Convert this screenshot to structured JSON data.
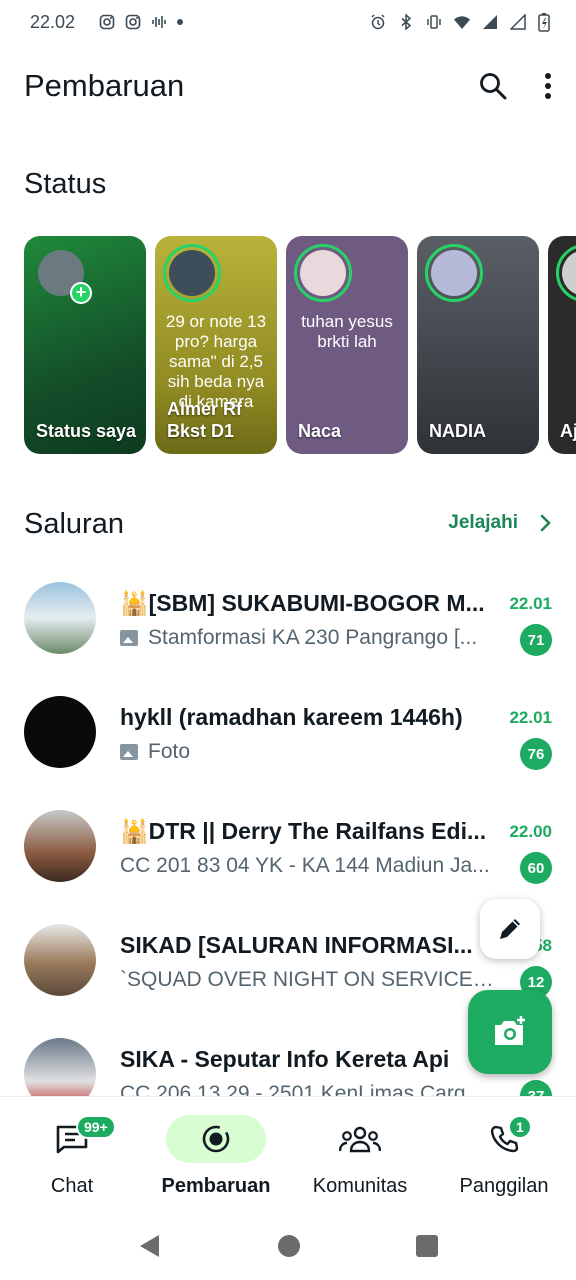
{
  "status_bar": {
    "time": "22.02",
    "left_icons": [
      "instagram-icon",
      "instagram-icon",
      "voice-icon",
      "dot-icon"
    ],
    "right_icons": [
      "alarm-icon",
      "bluetooth-icon",
      "vibrate-icon",
      "wifi-icon",
      "signal-icon",
      "signal-icon",
      "battery-charging-icon"
    ]
  },
  "appbar": {
    "title": "Pembaruan",
    "search_icon": "search-icon",
    "menu_icon": "more-vert-icon"
  },
  "status": {
    "section_title": "Status",
    "cards": [
      {
        "name": "Status saya",
        "text": "",
        "has_add": true,
        "bg": "#1f6b2a"
      },
      {
        "name": "Almer Rf Bkst D1",
        "text": "29 or note 13 pro? harga sama\" di 2,5 sih beda nya di kamera",
        "has_add": false,
        "bg": "#a9a32e"
      },
      {
        "name": "Naca",
        "text": "tuhan yesus brkti lah",
        "has_add": false,
        "bg": "#6f5a82"
      },
      {
        "name": "NADIA",
        "text": "",
        "has_add": false,
        "bg": "#3c3f44"
      },
      {
        "name": "Aj",
        "text": "",
        "has_add": false,
        "bg": "#2b2b2b"
      }
    ]
  },
  "channels": {
    "section_title": "Saluran",
    "explore_label": "Jelajahi",
    "items": [
      {
        "name": "🕌[SBM] SUKABUMI-BOGOR M...",
        "time": "22.01",
        "preview": "Stamformasi KA 230 Pangrango [...",
        "has_image": true,
        "unread": "71",
        "avatar_color": "#5f8aa8"
      },
      {
        "name": "hykll (ramadhan kareem 1446h)",
        "time": "22.01",
        "preview": "Foto",
        "has_image": true,
        "unread": "76",
        "avatar_color": "#0a0a0a"
      },
      {
        "name": "🕌DTR || Derry The Railfans Edi...",
        "time": "22.00",
        "preview": "CC 201 83 04 YK - KA 144 Madiun Ja...",
        "has_image": false,
        "unread": "60",
        "avatar_color": "#7a4b3a"
      },
      {
        "name": "SIKAD [SALURAN INFORMASI...",
        "time": "58",
        "preview": "`SQUAD OVER NIGHT ON SERVICES`...",
        "has_image": false,
        "unread": "12",
        "avatar_color": "#8a6a4a"
      },
      {
        "name": "SIKA - Seputar Info Kereta Api",
        "time": "",
        "preview": "CC 206 13 29 - 2501 KenLimas Carg...",
        "has_image": false,
        "unread": "37",
        "avatar_color": "#4a6a8a"
      }
    ]
  },
  "fab": {
    "edit_icon": "pencil-icon",
    "camera_icon": "camera-add-icon"
  },
  "bottom_nav": {
    "items": [
      {
        "label": "Chat",
        "icon": "chat-icon",
        "badge": "99+",
        "active": false
      },
      {
        "label": "Pembaruan",
        "icon": "updates-icon",
        "badge": "",
        "active": true
      },
      {
        "label": "Komunitas",
        "icon": "communities-icon",
        "badge": "",
        "active": false
      },
      {
        "label": "Panggilan",
        "icon": "phone-icon",
        "badge": "1",
        "active": false
      }
    ]
  },
  "system_nav": [
    "back-icon",
    "home-icon",
    "recents-icon"
  ],
  "colors": {
    "accent": "#1daa61",
    "accent_text": "#1b8755",
    "active_pill": "#d8fdd2",
    "muted_text": "#54656f"
  }
}
